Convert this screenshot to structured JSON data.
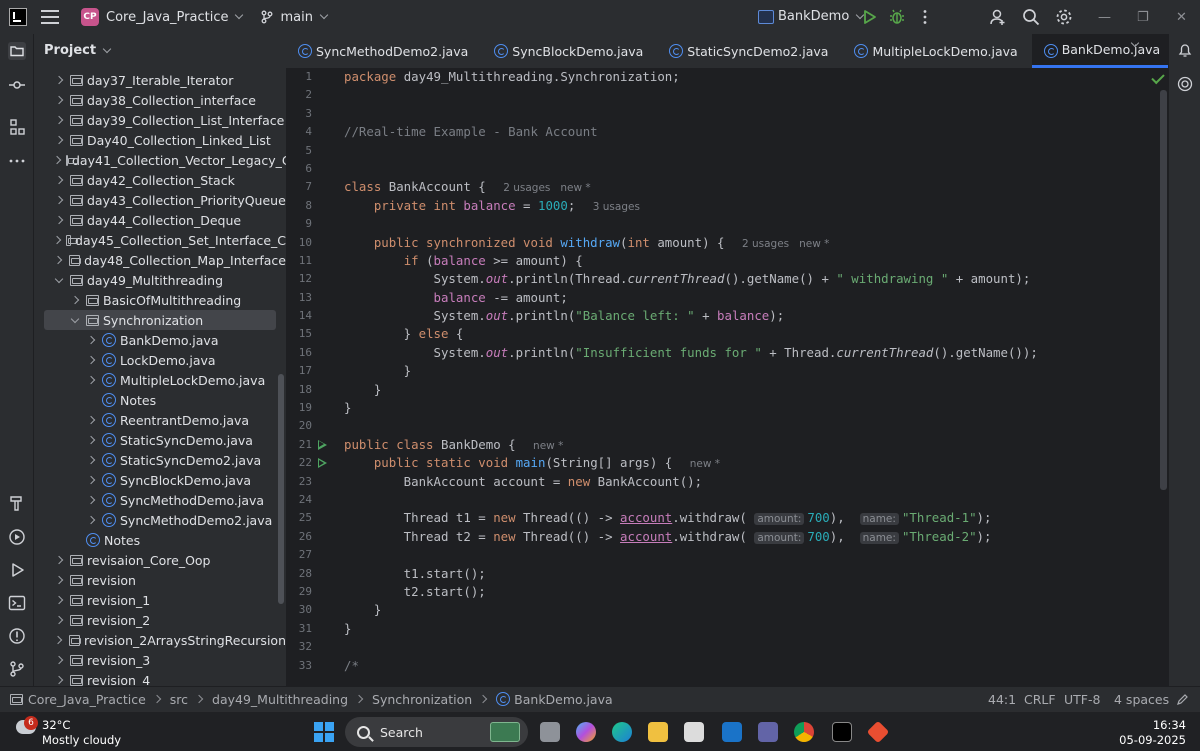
{
  "titlebar": {
    "project_badge": "CP",
    "project_name": "Core_Java_Practice",
    "branch": "main",
    "run_config": "BankDemo"
  },
  "project_panel": {
    "title": "Project",
    "items": [
      {
        "label": "day37_Iterable_Iterator",
        "type": "folder",
        "indent": 2,
        "state": "collapsed"
      },
      {
        "label": "day38_Collection_interface",
        "type": "folder",
        "indent": 2,
        "state": "collapsed"
      },
      {
        "label": "day39_Collection_List_Interface",
        "type": "folder",
        "indent": 2,
        "state": "collapsed"
      },
      {
        "label": "Day40_Collection_Linked_List",
        "type": "folder",
        "indent": 2,
        "state": "collapsed"
      },
      {
        "label": "day41_Collection_Vector_Legacy_C",
        "type": "folder",
        "indent": 2,
        "state": "collapsed"
      },
      {
        "label": "day42_Collection_Stack",
        "type": "folder",
        "indent": 2,
        "state": "collapsed"
      },
      {
        "label": "day43_Collection_PriorityQueue",
        "type": "folder",
        "indent": 2,
        "state": "collapsed"
      },
      {
        "label": "day44_Collection_Deque",
        "type": "folder",
        "indent": 2,
        "state": "collapsed"
      },
      {
        "label": "day45_Collection_Set_Interface_C",
        "type": "folder",
        "indent": 2,
        "state": "collapsed"
      },
      {
        "label": "day48_Collection_Map_Interface",
        "type": "folder",
        "indent": 2,
        "state": "collapsed"
      },
      {
        "label": "day49_Multithreading",
        "type": "folder",
        "indent": 2,
        "state": "expanded"
      },
      {
        "label": "BasicOfMultithreading",
        "type": "folder",
        "indent": 3,
        "state": "collapsed"
      },
      {
        "label": "Synchronization",
        "type": "folder",
        "indent": 3,
        "state": "expanded",
        "selected": true
      },
      {
        "label": "BankDemo.java",
        "type": "class",
        "indent": 4,
        "state": "collapsed"
      },
      {
        "label": "LockDemo.java",
        "type": "class",
        "indent": 4,
        "state": "collapsed"
      },
      {
        "label": "MultipleLockDemo.java",
        "type": "class",
        "indent": 4,
        "state": "collapsed"
      },
      {
        "label": "Notes",
        "type": "class",
        "indent": 4,
        "state": "none"
      },
      {
        "label": "ReentrantDemo.java",
        "type": "class",
        "indent": 4,
        "state": "collapsed"
      },
      {
        "label": "StaticSyncDemo.java",
        "type": "class",
        "indent": 4,
        "state": "collapsed"
      },
      {
        "label": "StaticSyncDemo2.java",
        "type": "class",
        "indent": 4,
        "state": "collapsed"
      },
      {
        "label": "SyncBlockDemo.java",
        "type": "class",
        "indent": 4,
        "state": "collapsed"
      },
      {
        "label": "SyncMethodDemo.java",
        "type": "class",
        "indent": 4,
        "state": "collapsed"
      },
      {
        "label": "SyncMethodDemo2.java",
        "type": "class",
        "indent": 4,
        "state": "collapsed"
      },
      {
        "label": "Notes",
        "type": "class",
        "indent": 3,
        "state": "none"
      },
      {
        "label": "revisaion_Core_Oop",
        "type": "folder",
        "indent": 2,
        "state": "collapsed"
      },
      {
        "label": "revision",
        "type": "folder",
        "indent": 2,
        "state": "collapsed"
      },
      {
        "label": "revision_1",
        "type": "folder",
        "indent": 2,
        "state": "collapsed"
      },
      {
        "label": "revision_2",
        "type": "folder",
        "indent": 2,
        "state": "collapsed"
      },
      {
        "label": "revision_2ArraysStringRecursion",
        "type": "folder",
        "indent": 2,
        "state": "collapsed"
      },
      {
        "label": "revision_3",
        "type": "folder",
        "indent": 2,
        "state": "collapsed"
      },
      {
        "label": "revision_4",
        "type": "folder",
        "indent": 2,
        "state": "collapsed"
      }
    ]
  },
  "tabs": [
    {
      "label": "SyncMethodDemo2.java",
      "active": false
    },
    {
      "label": "SyncBlockDemo.java",
      "active": false
    },
    {
      "label": "StaticSyncDemo2.java",
      "active": false
    },
    {
      "label": "MultipleLockDemo.java",
      "active": false
    },
    {
      "label": "BankDemo.java",
      "active": true
    }
  ],
  "editor": {
    "line_numbers": [
      "1",
      "2",
      "3",
      "4",
      "5",
      "6",
      "7",
      "8",
      "9",
      "10",
      "11",
      "12",
      "13",
      "14",
      "15",
      "16",
      "17",
      "18",
      "19",
      "20",
      "21",
      "22",
      "23",
      "24",
      "25",
      "26",
      "27",
      "28",
      "29",
      "30",
      "31",
      "32",
      "33"
    ],
    "run_gutter_lines": [
      21,
      22
    ],
    "lines": [
      [
        {
          "t": "package ",
          "c": "kw"
        },
        {
          "t": "day49_Multithreading.Synchronization;"
        }
      ],
      [],
      [],
      [
        {
          "t": "//Real-time Example - Bank Account",
          "c": "cmt"
        }
      ],
      [],
      [],
      [
        {
          "t": "class ",
          "c": "kw"
        },
        {
          "t": "BankAccount { "
        },
        {
          "t": "2 usages",
          "c": "hint"
        },
        {
          "t": "new *",
          "c": "hint"
        }
      ],
      [
        {
          "t": "    "
        },
        {
          "t": "private int ",
          "c": "kw"
        },
        {
          "t": "balance",
          "c": "fld"
        },
        {
          "t": " = "
        },
        {
          "t": "1000",
          "c": "num"
        },
        {
          "t": "; "
        },
        {
          "t": "3 usages",
          "c": "hint"
        }
      ],
      [],
      [
        {
          "t": "    "
        },
        {
          "t": "public synchronized void ",
          "c": "kw"
        },
        {
          "t": "withdraw",
          "c": "fn"
        },
        {
          "t": "("
        },
        {
          "t": "int ",
          "c": "kw"
        },
        {
          "t": "amount) { "
        },
        {
          "t": "2 usages",
          "c": "hint"
        },
        {
          "t": "new *",
          "c": "hint"
        }
      ],
      [
        {
          "t": "        "
        },
        {
          "t": "if ",
          "c": "kw"
        },
        {
          "t": "("
        },
        {
          "t": "balance",
          "c": "fld"
        },
        {
          "t": " >= amount) {"
        }
      ],
      [
        {
          "t": "            System."
        },
        {
          "t": "out",
          "c": "fld ital"
        },
        {
          "t": ".println(Thread."
        },
        {
          "t": "currentThread",
          "c": "ital"
        },
        {
          "t": "().getName() + "
        },
        {
          "t": "\" withdrawing \"",
          "c": "str"
        },
        {
          "t": " + amount);"
        }
      ],
      [
        {
          "t": "            "
        },
        {
          "t": "balance",
          "c": "fld"
        },
        {
          "t": " -= amount;"
        }
      ],
      [
        {
          "t": "            System."
        },
        {
          "t": "out",
          "c": "fld ital"
        },
        {
          "t": ".println("
        },
        {
          "t": "\"Balance left: \"",
          "c": "str"
        },
        {
          "t": " + "
        },
        {
          "t": "balance",
          "c": "fld"
        },
        {
          "t": ");"
        }
      ],
      [
        {
          "t": "        } "
        },
        {
          "t": "else ",
          "c": "kw"
        },
        {
          "t": "{"
        }
      ],
      [
        {
          "t": "            System."
        },
        {
          "t": "out",
          "c": "fld ital"
        },
        {
          "t": ".println("
        },
        {
          "t": "\"Insufficient funds for \"",
          "c": "str"
        },
        {
          "t": " + Thread."
        },
        {
          "t": "currentThread",
          "c": "ital"
        },
        {
          "t": "().getName());"
        }
      ],
      [
        {
          "t": "        }"
        }
      ],
      [
        {
          "t": "    }"
        }
      ],
      [
        {
          "t": "}"
        }
      ],
      [],
      [
        {
          "t": "public class ",
          "c": "kw"
        },
        {
          "t": "BankDemo { "
        },
        {
          "t": "new *",
          "c": "hint"
        }
      ],
      [
        {
          "t": "    "
        },
        {
          "t": "public static void ",
          "c": "kw"
        },
        {
          "t": "main",
          "c": "fn"
        },
        {
          "t": "(String[] args) { "
        },
        {
          "t": "new *",
          "c": "hint"
        }
      ],
      [
        {
          "t": "        BankAccount account = "
        },
        {
          "t": "new ",
          "c": "kw"
        },
        {
          "t": "BankAccount();"
        }
      ],
      [],
      [
        {
          "t": "        Thread t1 = "
        },
        {
          "t": "new ",
          "c": "kw"
        },
        {
          "t": "Thread(() -> "
        },
        {
          "t": "account",
          "c": "fld ul"
        },
        {
          "t": ".withdraw( "
        },
        {
          "t": "amount:",
          "c": "inlay"
        },
        {
          "t": "700",
          "c": "num"
        },
        {
          "t": "),  "
        },
        {
          "t": "name:",
          "c": "inlay"
        },
        {
          "t": "\"Thread-1\"",
          "c": "str"
        },
        {
          "t": ");"
        }
      ],
      [
        {
          "t": "        Thread t2 = "
        },
        {
          "t": "new ",
          "c": "kw"
        },
        {
          "t": "Thread(() -> "
        },
        {
          "t": "account",
          "c": "fld ul"
        },
        {
          "t": ".withdraw( "
        },
        {
          "t": "amount:",
          "c": "inlay"
        },
        {
          "t": "700",
          "c": "num"
        },
        {
          "t": "),  "
        },
        {
          "t": "name:",
          "c": "inlay"
        },
        {
          "t": "\"Thread-2\"",
          "c": "str"
        },
        {
          "t": ");"
        }
      ],
      [],
      [
        {
          "t": "        t1.start();"
        }
      ],
      [
        {
          "t": "        t2.start();"
        }
      ],
      [
        {
          "t": "    }"
        }
      ],
      [
        {
          "t": "}"
        }
      ],
      [],
      [
        {
          "t": "/*",
          "c": "cmt"
        }
      ]
    ]
  },
  "statusbar": {
    "breadcrumb": [
      "Core_Java_Practice",
      "src",
      "day49_Multithreading",
      "Synchronization",
      "BankDemo.java"
    ],
    "position": "44:1",
    "line_sep": "CRLF",
    "encoding": "UTF-8",
    "indent": "4 spaces"
  },
  "taskbar": {
    "weather_badge": "6",
    "temperature": "32°C",
    "weather": "Mostly cloudy",
    "search_label": "Search",
    "time": "16:34",
    "date": "05-09-2025"
  },
  "colors": {
    "accent": "#3574f0",
    "keyword": "#cf8e6d",
    "number": "#2aacb8",
    "string": "#6aab73",
    "field": "#c77dbb",
    "function": "#56a8f5",
    "project_badge": "#c7548c"
  }
}
